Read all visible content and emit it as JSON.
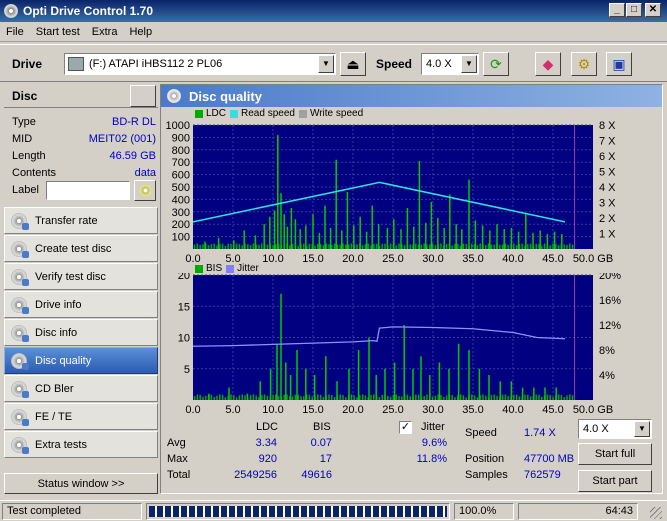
{
  "window": {
    "title": "Opti Drive Control 1.70"
  },
  "menu": [
    "File",
    "Start test",
    "Extra",
    "Help"
  ],
  "toolbar": {
    "drive_label": "Drive",
    "drive_value": "(F:)  ATAPI iHBS112  2 PL06",
    "speed_label": "Speed",
    "speed_value": "4.0 X"
  },
  "disc": {
    "header": "Disc",
    "type_label": "Type",
    "type_value": "BD-R DL",
    "mid_label": "MID",
    "mid_value": "MEIT02 (001)",
    "length_label": "Length",
    "length_value": "46.59 GB",
    "contents_label": "Contents",
    "contents_value": "data",
    "label_label": "Label",
    "label_value": ""
  },
  "nav": [
    "Transfer rate",
    "Create test disc",
    "Verify test disc",
    "Drive info",
    "Disc info",
    "Disc quality",
    "CD Bler",
    "FE / TE",
    "Extra tests"
  ],
  "nav_active": "Disc quality",
  "status_window_button": "Status window >>",
  "panel": {
    "title": "Disc quality"
  },
  "chart_data": [
    {
      "type": "bar",
      "legend": [
        "LDC",
        "Read speed",
        "Write speed"
      ],
      "colors": {
        "LDC": "#00aa00",
        "Read speed": "#33e0e0",
        "Write speed": "#a0a0a0"
      },
      "x_ticks": [
        "0.0",
        "5.0",
        "10.0",
        "15.0",
        "20.0",
        "25.0",
        "30.0",
        "35.0",
        "40.0",
        "45.0",
        "50.0 GB"
      ],
      "y_ticks_left": [
        "1000",
        "900",
        "800",
        "700",
        "600",
        "500",
        "400",
        "300",
        "200",
        "100"
      ],
      "y_ticks_right": [
        "8 X",
        "7 X",
        "6 X",
        "5 X",
        "4 X",
        "3 X",
        "2 X",
        "1 X"
      ],
      "xlim": [
        0,
        50
      ],
      "ylim": [
        0,
        1000
      ],
      "y2lim": [
        0,
        8
      ],
      "read_speed": {
        "x": [
          0,
          23.3,
          46.5
        ],
        "y": [
          1.75,
          4.3,
          1.75
        ]
      },
      "ldc_spikes": {
        "x": [
          1.5,
          3.2,
          5.1,
          6.4,
          7.8,
          8.9,
          9.6,
          10.2,
          10.6,
          11.0,
          11.4,
          11.8,
          12.3,
          12.8,
          13.4,
          14.1,
          15.0,
          15.8,
          16.5,
          17.2,
          17.9,
          18.6,
          19.3,
          20.1,
          20.9,
          21.7,
          22.4,
          23.2,
          24.3,
          25.1,
          26.0,
          26.8,
          27.6,
          28.3,
          29.1,
          29.8,
          30.6,
          31.4,
          32.1,
          32.9,
          33.6,
          34.5,
          35.3,
          36.2,
          37.1,
          38.0,
          38.9,
          39.8,
          40.7,
          41.6,
          42.5,
          43.4,
          44.3,
          45.2,
          46.1
        ],
        "y": [
          60,
          90,
          70,
          150,
          110,
          200,
          260,
          310,
          920,
          450,
          280,
          180,
          330,
          240,
          160,
          190,
          280,
          130,
          350,
          170,
          720,
          150,
          460,
          190,
          260,
          140,
          350,
          200,
          170,
          240,
          160,
          330,
          180,
          710,
          210,
          380,
          250,
          170,
          440,
          200,
          160,
          560,
          230,
          190,
          150,
          200,
          160,
          170,
          140,
          280,
          130,
          150,
          120,
          140,
          120
        ]
      }
    },
    {
      "type": "bar",
      "legend": [
        "BIS",
        "Jitter"
      ],
      "colors": {
        "BIS": "#00aa00",
        "Jitter": "#8080ff"
      },
      "x_ticks": [
        "0.0",
        "5.0",
        "10.0",
        "15.0",
        "20.0",
        "25.0",
        "30.0",
        "35.0",
        "40.0",
        "45.0",
        "50.0 GB"
      ],
      "y_ticks_left": [
        "20",
        "15",
        "10",
        "5"
      ],
      "y_ticks_right": [
        "20%",
        "16%",
        "12%",
        "8%",
        "4%"
      ],
      "xlim": [
        0,
        50
      ],
      "ylim": [
        0,
        20
      ],
      "y2lim": [
        0,
        20
      ],
      "jitter": {
        "x": [
          0,
          5,
          10,
          15,
          20,
          22.5,
          23.0,
          23.3,
          25,
          30,
          35,
          40,
          43,
          46.5
        ],
        "y": [
          8.6,
          8.7,
          8.9,
          9.1,
          9.3,
          9.5,
          9.4,
          11.5,
          11.7,
          11.6,
          11.4,
          10.8,
          10.0,
          9.8
        ]
      },
      "bis_spikes": {
        "x": [
          2.0,
          4.5,
          6.8,
          8.4,
          9.7,
          10.5,
          11.0,
          11.6,
          12.2,
          13.0,
          14.1,
          15.2,
          16.6,
          18.0,
          19.5,
          20.7,
          22.0,
          22.9,
          24.0,
          25.2,
          26.4,
          27.5,
          28.5,
          29.6,
          30.8,
          32.0,
          33.2,
          34.5,
          35.8,
          37.0,
          38.4,
          39.8,
          41.2,
          42.6,
          44.0,
          45.4
        ],
        "y": [
          1,
          2,
          1,
          3,
          5,
          9,
          17,
          6,
          4,
          8,
          5,
          4,
          7,
          3,
          5,
          8,
          10,
          4,
          5,
          6,
          12,
          5,
          7,
          4,
          6,
          5,
          9,
          8,
          5,
          4,
          3,
          3,
          2,
          2,
          2,
          2
        ]
      }
    }
  ],
  "stats": {
    "col_ldc": "LDC",
    "col_bis": "BIS",
    "avg_label": "Avg",
    "avg_ldc": "3.34",
    "avg_bis": "0.07",
    "max_label": "Max",
    "max_ldc": "920",
    "max_bis": "17",
    "total_label": "Total",
    "total_ldc": "2549256",
    "total_bis": "49616",
    "jitter_label": "Jitter",
    "jitter_checked": true,
    "jitter_avg": "9.6%",
    "jitter_max": "11.8%",
    "speed_label": "Speed",
    "speed_value": "1.74 X",
    "position_label": "Position",
    "position_value": "47700 MB",
    "samples_label": "Samples",
    "samples_value": "762579",
    "speed_select": "4.0 X",
    "start_full": "Start full",
    "start_part": "Start part"
  },
  "status": {
    "text": "Test completed",
    "progress": 1.0,
    "percent": "100.0%",
    "time": "64:43"
  }
}
